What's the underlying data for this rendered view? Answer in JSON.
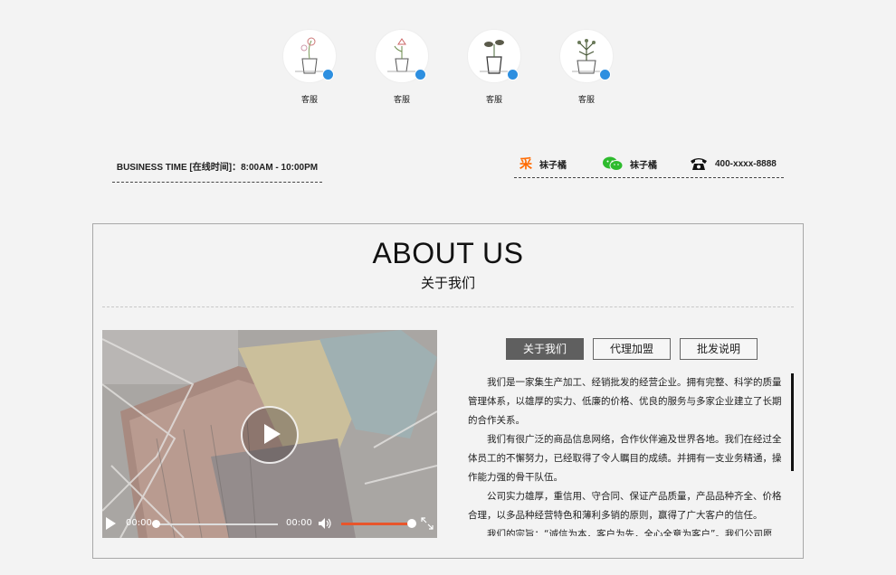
{
  "services": [
    {
      "label": "客服",
      "icon": "potted-flower-icon"
    },
    {
      "label": "客服",
      "icon": "potted-flower-icon"
    },
    {
      "label": "客服",
      "icon": "potted-plant-icon"
    },
    {
      "label": "客服",
      "icon": "potted-succulent-icon"
    }
  ],
  "business_time": "BUSINESS TIME [在线时间]：8:00AM - 10:00PM",
  "contacts": [
    {
      "icon": "caigou-icon",
      "text": "袜子橘"
    },
    {
      "icon": "wechat-icon",
      "text": "袜子橘"
    },
    {
      "icon": "phone-icon",
      "text": "400-xxxx-8888"
    }
  ],
  "about": {
    "title": "ABOUT US",
    "subtitle": "关于我们",
    "tabs": [
      "关于我们",
      "代理加盟",
      "批发说明"
    ],
    "active_tab": 0,
    "paragraphs": [
      "我们是一家集生产加工、经销批发的经营企业。拥有完整、科学的质量管理体系，以雄厚的实力、低廉的价格、优良的服务与多家企业建立了长期的合作关系。",
      "我们有很广泛的商品信息网络，合作伙伴遍及世界各地。我们在经过全体员工的不懈努力，已经取得了令人瞩目的成绩。并拥有一支业务精通，操作能力强的骨干队伍。",
      "公司实力雄厚，重信用、守合同、保证产品质量，产品品种齐全、价格合理，以多品种经营特色和薄利多销的原则，赢得了广大客户的信任。",
      "我们的宗旨：“诚信为本，客户为先，全心全意为客户”。我们公司愿"
    ]
  },
  "video": {
    "current_time": "00:00",
    "duration": "00:00",
    "progress": 0,
    "volume": 1.0,
    "accent": "#e8552b"
  },
  "colors": {
    "background": "#f3f3f3",
    "tab_active": "#5f5f5f",
    "caigou": "#ff6a00",
    "wechat": "#2dbb2d"
  }
}
